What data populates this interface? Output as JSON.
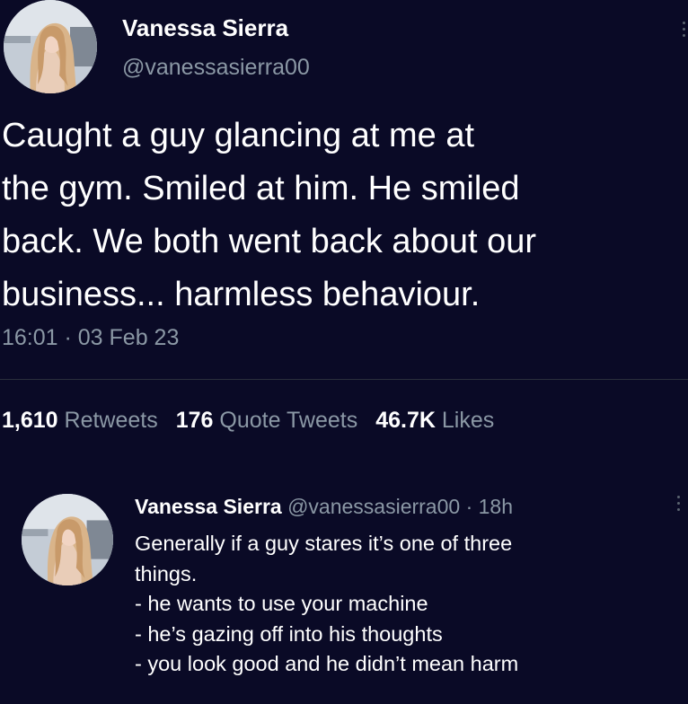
{
  "tweet": {
    "author": {
      "name": "Vanessa Sierra",
      "handle": "@vanessasierra00"
    },
    "text_lines": [
      "Caught a guy glancing at me at",
      "the gym. Smiled at him. He smiled",
      "back. We both went back about our",
      "business... harmless behaviour."
    ],
    "timestamp": "16:01 · 03 Feb 23",
    "stats": {
      "retweets_count": "1,610",
      "retweets_label": "Retweets",
      "quotes_count": "176",
      "quotes_label": "Quote Tweets",
      "likes_count": "46.7K",
      "likes_label": "Likes"
    }
  },
  "reply": {
    "author": {
      "name": "Vanessa Sierra",
      "handle": "@vanessasierra00"
    },
    "separator": " · ",
    "time": "18h",
    "text_lines": [
      "Generally if a guy stares it’s one of three",
      "things.",
      "- he wants to use your machine",
      "- he’s gazing off into his thoughts",
      "- you look good and he didn’t mean harm"
    ]
  },
  "colors": {
    "background": "#0a0a26",
    "primary_text": "#ffffff",
    "secondary_text": "#8b98a5",
    "divider": "#2a2f3c"
  },
  "icons": {
    "more": "more-options-icon",
    "avatar": "profile-photo"
  }
}
